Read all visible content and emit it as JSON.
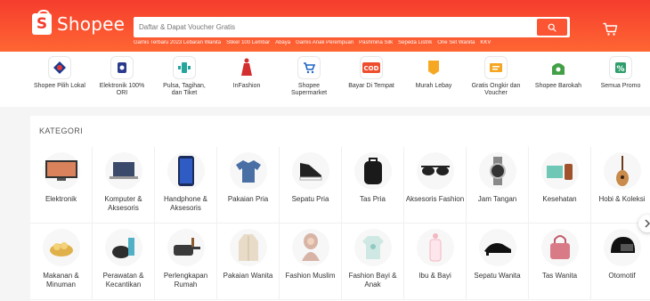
{
  "header": {
    "brand": "Shopee",
    "brand_initial": "S",
    "search_placeholder": "Daftar & Dapat Voucher Gratis",
    "hints": [
      "Gamis Terbaru 2023 Lebaran Wanita",
      "Stiker 100 Lembar",
      "Abaya",
      "Gamis Anak Perempuan",
      "Pashmina Silk",
      "Sepeda Listrik",
      "One Set Wanita",
      "KKV"
    ],
    "accent_color": "#f53d2d"
  },
  "quick_links": [
    {
      "label": "Shopee Pilih Lokal",
      "icon": "badge-icon"
    },
    {
      "label": "Elektronik 100% ORI",
      "icon": "electronics-icon"
    },
    {
      "label": "Pulsa, Tagihan, dan Tiket",
      "icon": "phone-bill-icon"
    },
    {
      "label": "InFashion",
      "icon": "fashion-icon"
    },
    {
      "label": "Shopee Supermarket",
      "icon": "cart-icon"
    },
    {
      "label": "Bayar Di Tempat",
      "icon": "cod-icon"
    },
    {
      "label": "Murah Lebay",
      "icon": "tag-icon"
    },
    {
      "label": "Gratis Ongkir dan Voucher",
      "icon": "voucher-icon"
    },
    {
      "label": "Shopee Barokah",
      "icon": "mosque-icon"
    },
    {
      "label": "Semua Promo",
      "icon": "promo-icon"
    }
  ],
  "categories": {
    "title": "KATEGORI",
    "items": [
      {
        "label": "Elektronik",
        "icon": "tv-icon"
      },
      {
        "label": "Komputer & Aksesoris",
        "icon": "laptop-icon"
      },
      {
        "label": "Handphone & Aksesoris",
        "icon": "smartphone-icon"
      },
      {
        "label": "Pakaian Pria",
        "icon": "shirt-icon"
      },
      {
        "label": "Sepatu Pria",
        "icon": "sneaker-icon"
      },
      {
        "label": "Tas Pria",
        "icon": "backpack-icon"
      },
      {
        "label": "Aksesoris Fashion",
        "icon": "sunglasses-icon"
      },
      {
        "label": "Jam Tangan",
        "icon": "watch-icon"
      },
      {
        "label": "Kesehatan",
        "icon": "health-icon"
      },
      {
        "label": "Hobi & Koleksi",
        "icon": "guitar-icon"
      },
      {
        "label": "Makanan & Minuman",
        "icon": "food-icon"
      },
      {
        "label": "Perawatan & Kecantikan",
        "icon": "cosmetics-icon"
      },
      {
        "label": "Perlengkapan Rumah",
        "icon": "cookware-icon"
      },
      {
        "label": "Pakaian Wanita",
        "icon": "blazer-icon"
      },
      {
        "label": "Fashion Muslim",
        "icon": "hijab-icon"
      },
      {
        "label": "Fashion Bayi & Anak",
        "icon": "baby-clothes-icon"
      },
      {
        "label": "Ibu & Bayi",
        "icon": "baby-bottle-icon"
      },
      {
        "label": "Sepatu Wanita",
        "icon": "heels-icon"
      },
      {
        "label": "Tas Wanita",
        "icon": "handbag-icon"
      },
      {
        "label": "Otomotif",
        "icon": "helmet-icon"
      }
    ]
  }
}
